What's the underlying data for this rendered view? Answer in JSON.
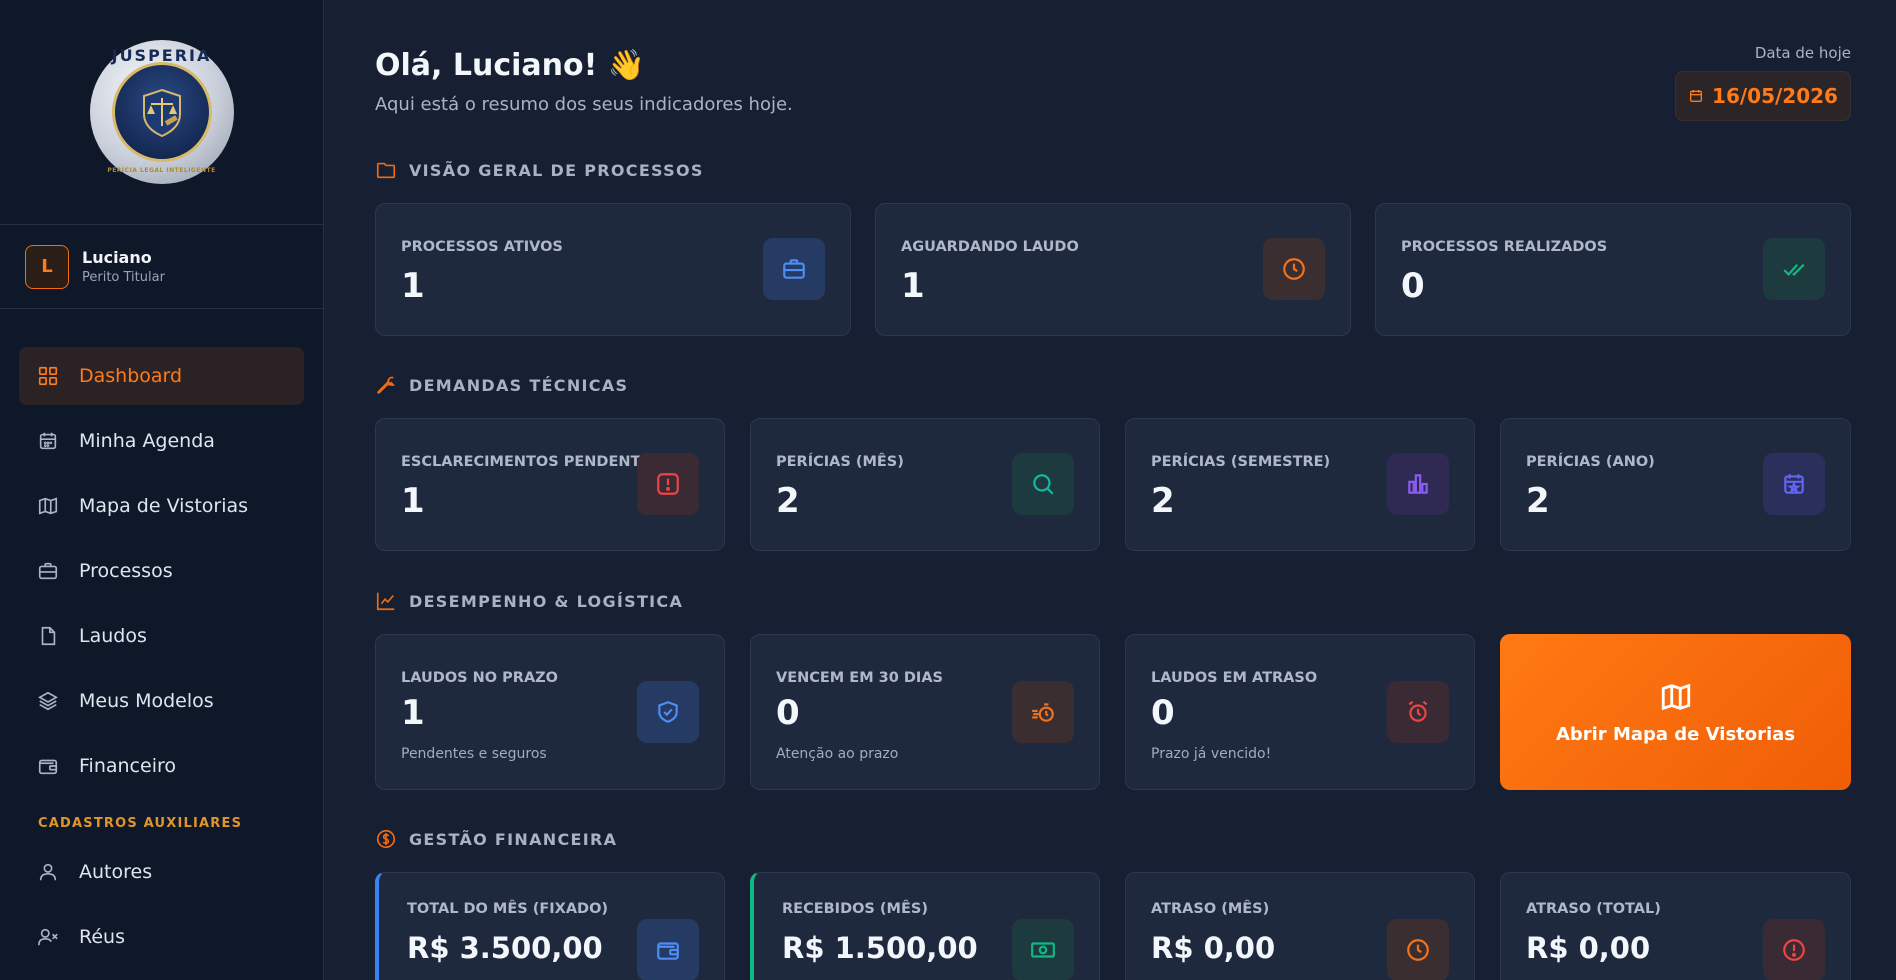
{
  "brand": {
    "logo_text": "JUSPERIA",
    "logo_tagline": "PERÍCIA LEGAL INTELIGENTE"
  },
  "user": {
    "initial": "L",
    "name": "Luciano",
    "role": "Perito Titular"
  },
  "nav": {
    "items": [
      {
        "label": "Dashboard",
        "icon": "grid-icon",
        "active": true
      },
      {
        "label": "Minha Agenda",
        "icon": "calendar-icon"
      },
      {
        "label": "Mapa de Vistorias",
        "icon": "map-icon"
      },
      {
        "label": "Processos",
        "icon": "briefcase-icon"
      },
      {
        "label": "Laudos",
        "icon": "file-icon"
      },
      {
        "label": "Meus Modelos",
        "icon": "layers-icon"
      },
      {
        "label": "Financeiro",
        "icon": "wallet-icon"
      }
    ],
    "section_label": "CADASTROS AUXILIARES",
    "aux_items": [
      {
        "label": "Autores",
        "icon": "user-icon"
      },
      {
        "label": "Réus",
        "icon": "user-x-icon"
      }
    ]
  },
  "header": {
    "greeting": "Olá, Luciano! 👋",
    "subtitle": "Aqui está o resumo dos seus indicadores hoje.",
    "date_label": "Data de hoje",
    "date_value": "16/05/2026"
  },
  "sections": {
    "overview": "VISÃO GERAL DE PROCESSOS",
    "demands": "DEMANDAS TÉCNICAS",
    "performance": "DESEMPENHO & LOGÍSTICA",
    "finance": "GESTÃO FINANCEIRA"
  },
  "overview_cards": [
    {
      "label": "PROCESSOS ATIVOS",
      "value": "1",
      "icon": "briefcase-icon"
    },
    {
      "label": "AGUARDANDO LAUDO",
      "value": "1",
      "icon": "clock-icon"
    },
    {
      "label": "PROCESSOS REALIZADOS",
      "value": "0",
      "icon": "double-check-icon"
    }
  ],
  "demand_cards": [
    {
      "label": "ESCLARECIMENTOS PENDENTES",
      "value": "1",
      "icon": "alert-square-icon"
    },
    {
      "label": "PERÍCIAS (MÊS)",
      "value": "2",
      "icon": "search-icon"
    },
    {
      "label": "PERÍCIAS (SEMESTRE)",
      "value": "2",
      "icon": "bar-chart-icon"
    },
    {
      "label": "PERÍCIAS (ANO)",
      "value": "2",
      "icon": "calendar-star-icon"
    }
  ],
  "performance_cards": [
    {
      "label": "LAUDOS NO PRAZO",
      "value": "1",
      "note": "Pendentes e seguros",
      "icon": "shield-check-icon"
    },
    {
      "label": "VENCEM EM 30 DIAS",
      "value": "0",
      "note": "Atenção ao prazo",
      "icon": "timer-icon"
    },
    {
      "label": "LAUDOS EM ATRASO",
      "value": "0",
      "note": "Prazo já vencido!",
      "icon": "alarm-icon"
    }
  ],
  "cta": {
    "label": "Abrir Mapa de Vistorias",
    "icon": "map-icon"
  },
  "finance_cards": [
    {
      "label": "TOTAL DO MÊS (FIXADO)",
      "value": "R$ 3.500,00",
      "icon": "wallet-icon",
      "accent": "#3b82f6"
    },
    {
      "label": "RECEBIDOS (MÊS)",
      "value": "R$ 1.500,00",
      "icon": "banknote-icon",
      "accent": "#10b981"
    },
    {
      "label": "ATRASO (MÊS)",
      "value": "R$ 0,00",
      "icon": "clock-icon"
    },
    {
      "label": "ATRASO (TOTAL)",
      "value": "R$ 0,00",
      "icon": "alert-circle-icon"
    }
  ],
  "colors": {
    "accent": "#f26b10",
    "background": "#162032",
    "sidebar": "#0f1828",
    "card": "#1e293d"
  }
}
